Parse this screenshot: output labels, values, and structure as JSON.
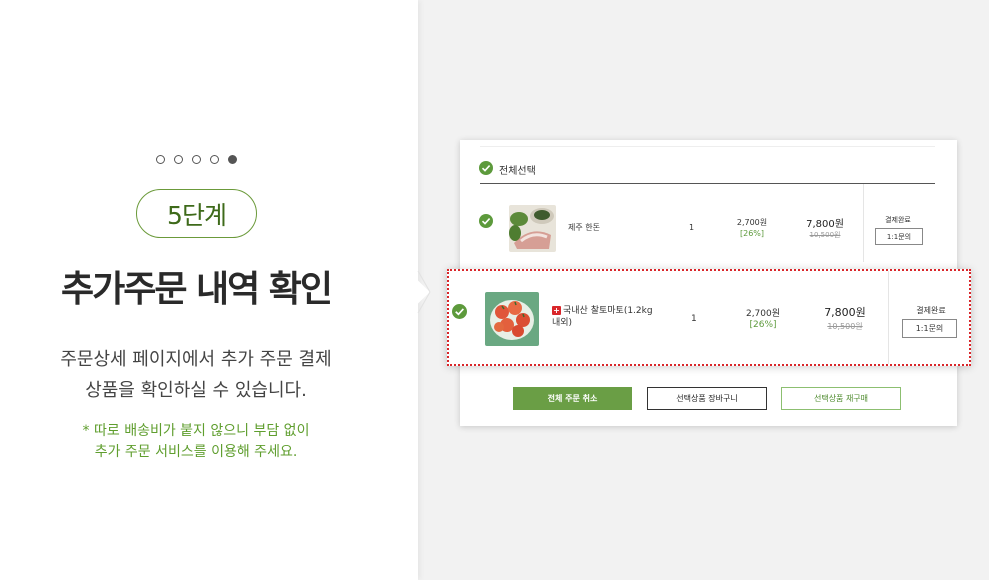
{
  "left": {
    "step_label": "5단계",
    "title": "추가주문 내역 확인",
    "desc_line1": "주문상세 페이지에서  추가 주문 결제",
    "desc_line2": "상품을 확인하실 수 있습니다.",
    "note_line1": "* 따로 배송비가 붙지 않으니 부담 없이",
    "note_line2": "추가 주문 서비스를 이용해 주세요.",
    "dots_total": 5,
    "dots_active_index": 4
  },
  "order": {
    "select_all_label": "전체선택",
    "rows": [
      {
        "name": "제주 한돈",
        "qty": "1",
        "unit_price": "2,700원",
        "discount": "[26%]",
        "final_price": "7,800원",
        "original_price": "10,500원",
        "status": "결제완료",
        "inquiry_label": "1:1문의",
        "checked": true
      },
      {
        "badge": "+",
        "name_line1": "국내산 찰토마토(1.2kg",
        "name_line2": "내외)",
        "qty": "1",
        "unit_price": "2,700원",
        "discount": "[26%]",
        "final_price": "7,800원",
        "original_price": "10,500원",
        "status": "결제완료",
        "inquiry_label": "1:1문의",
        "checked": true
      }
    ],
    "buttons": {
      "cancel_all": "전체 주문 취소",
      "add_to_cart": "선택상품 장바구니",
      "reorder": "선택상품 재구매"
    }
  },
  "colors": {
    "accent_green": "#6a9e45",
    "highlight_red": "#d9262a"
  },
  "icons": [
    "check-circle-icon",
    "plus-badge-icon"
  ]
}
